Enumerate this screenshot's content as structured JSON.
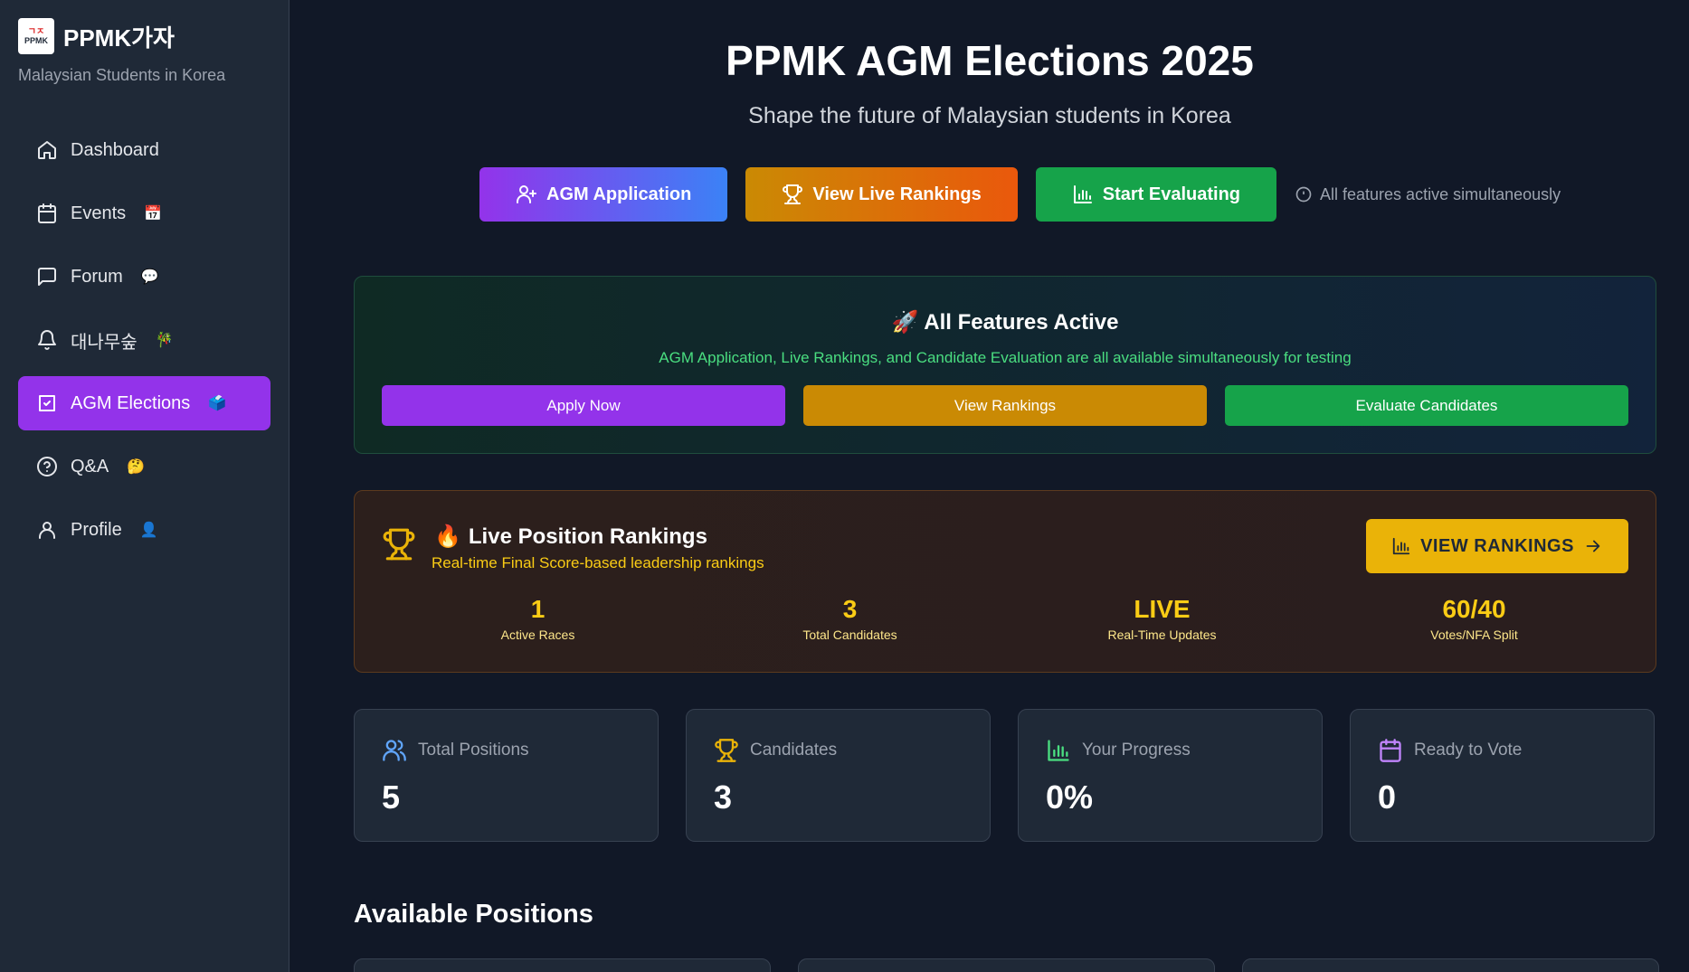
{
  "brand": {
    "logo_text": "PPMK",
    "logo_kr": "ㄱㅈ",
    "name": "PPMK가자",
    "subtitle": "Malaysian Students in Korea"
  },
  "sidebar": {
    "items": [
      {
        "label": "Dashboard",
        "emoji": "",
        "icon": "home-icon"
      },
      {
        "label": "Events",
        "emoji": "📅",
        "icon": "calendar-icon"
      },
      {
        "label": "Forum",
        "emoji": "💬",
        "icon": "message-square-icon"
      },
      {
        "label": "대나무숲",
        "emoji": "🎋",
        "icon": "bell-icon"
      },
      {
        "label": "AGM Elections",
        "emoji": "🗳️",
        "icon": "vote-icon",
        "active": true
      },
      {
        "label": "Q&A",
        "emoji": "🤔",
        "icon": "help-circle-icon"
      },
      {
        "label": "Profile",
        "emoji": "👤",
        "icon": "user-icon"
      }
    ]
  },
  "header": {
    "title": "PPMK AGM Elections 2025",
    "subtitle": "Shape the future of Malaysian students in Korea"
  },
  "hero_actions": {
    "application": "AGM Application",
    "live_rankings": "View Live Rankings",
    "evaluate": "Start Evaluating",
    "hint": "All features active simultaneously"
  },
  "features": {
    "emoji": "🚀",
    "title": "All Features Active",
    "description": "AGM Application, Live Rankings, and Candidate Evaluation are all available simultaneously for testing",
    "buttons": {
      "apply": "Apply Now",
      "rankings": "View Rankings",
      "evaluate": "Evaluate Candidates"
    }
  },
  "rankings": {
    "emoji": "🔥",
    "title": "Live Position Rankings",
    "subtitle": "Real-time Final Score-based leadership rankings",
    "button": "VIEW RANKINGS",
    "stats": [
      {
        "value": "1",
        "label": "Active Races"
      },
      {
        "value": "3",
        "label": "Total Candidates"
      },
      {
        "value": "LIVE",
        "label": "Real-Time Updates"
      },
      {
        "value": "60/40",
        "label": "Votes/NFA Split"
      }
    ]
  },
  "stats": [
    {
      "label": "Total Positions",
      "value": "5",
      "icon": "users-icon",
      "color": "#60a5fa"
    },
    {
      "label": "Candidates",
      "value": "3",
      "icon": "trophy-icon",
      "color": "#eab308"
    },
    {
      "label": "Your Progress",
      "value": "0%",
      "icon": "bar-chart-icon",
      "color": "#4ade80"
    },
    {
      "label": "Ready to Vote",
      "value": "0",
      "icon": "calendar-icon",
      "color": "#c084fc"
    }
  ],
  "section": {
    "available_positions": "Available Positions"
  },
  "colors": {
    "background": "#111827",
    "sidebar": "#1f2937",
    "accent_purple": "#9333ea",
    "accent_gold": "#eab308",
    "accent_green": "#16a34a"
  }
}
